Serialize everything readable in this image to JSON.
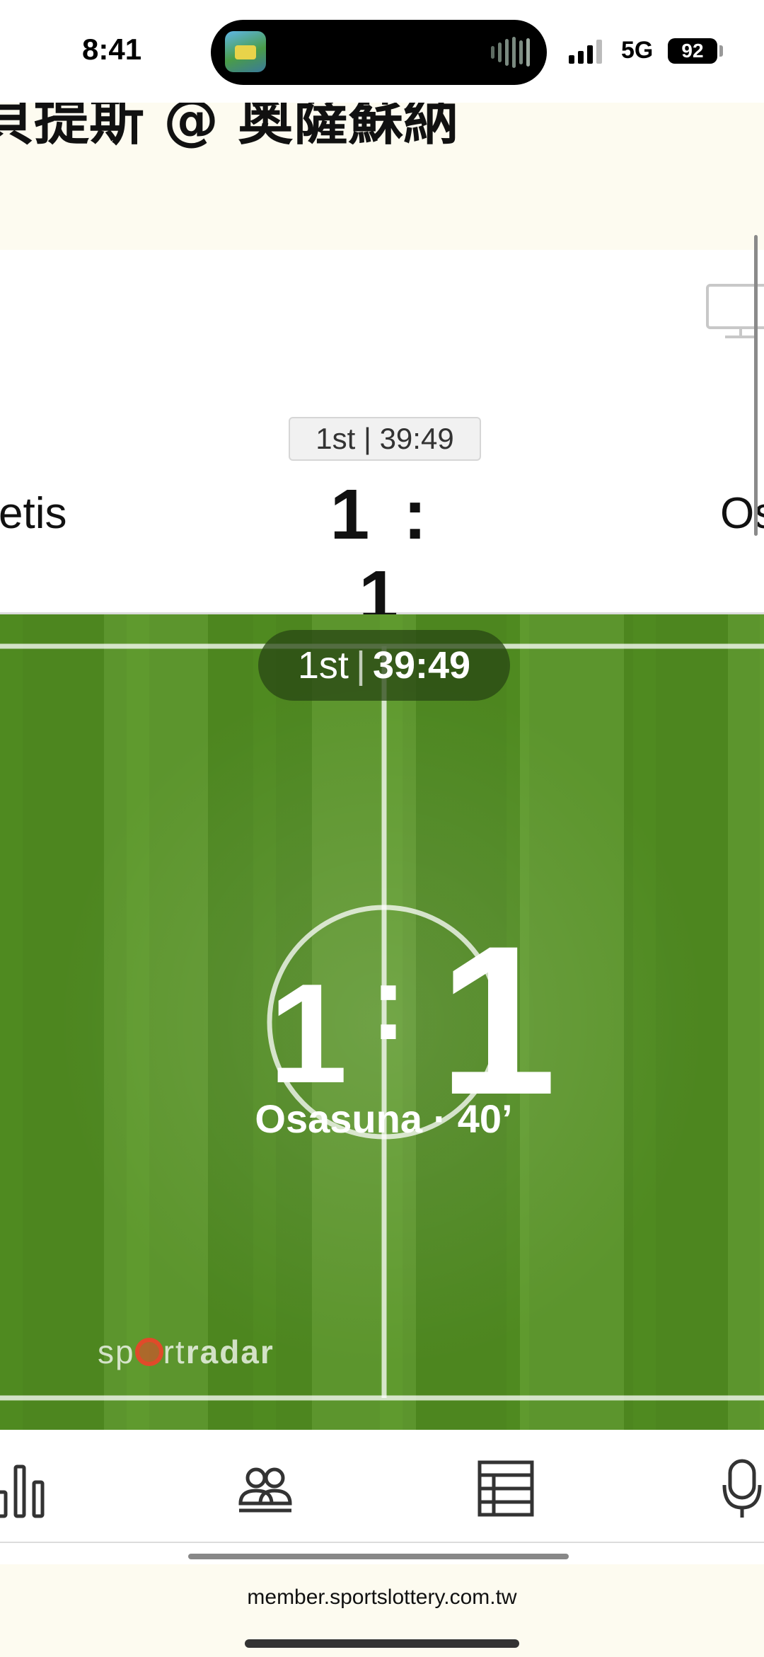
{
  "status_bar": {
    "time": "8:41",
    "network": "5G",
    "battery": "92",
    "icons": [
      "app-thumbnail-icon",
      "audio-wave-icon",
      "cellular-signal-icon",
      "battery-icon"
    ]
  },
  "header": {
    "title": "貝提斯 @ 奧薩蘇納"
  },
  "video_panel": {
    "icon": "tv-icon"
  },
  "score_panel": {
    "period_clock": "1st | 39:49",
    "home_team": "etis",
    "away_team": "Os",
    "score": "1 : 1"
  },
  "pitch": {
    "period": "1st",
    "separator": "|",
    "clock": "39:49",
    "home_score": "1",
    "colon": ":",
    "away_score": "1",
    "event_text": "Osasuna · 40’",
    "brand_prefix": "sp",
    "brand_suffix": "rt",
    "brand_bold": "radar",
    "colors": {
      "grass_dark": "#4f8a20",
      "grass_light": "#5f9a2e",
      "brand_accent": "#e04a2a"
    }
  },
  "tabs": [
    {
      "name": "statistics",
      "icon": "bar-chart-icon"
    },
    {
      "name": "lineups",
      "icon": "players-icon"
    },
    {
      "name": "standings",
      "icon": "table-icon"
    },
    {
      "name": "commentary",
      "icon": "microphone-icon"
    }
  ],
  "browser": {
    "url": "member.sportslottery.com.tw"
  }
}
